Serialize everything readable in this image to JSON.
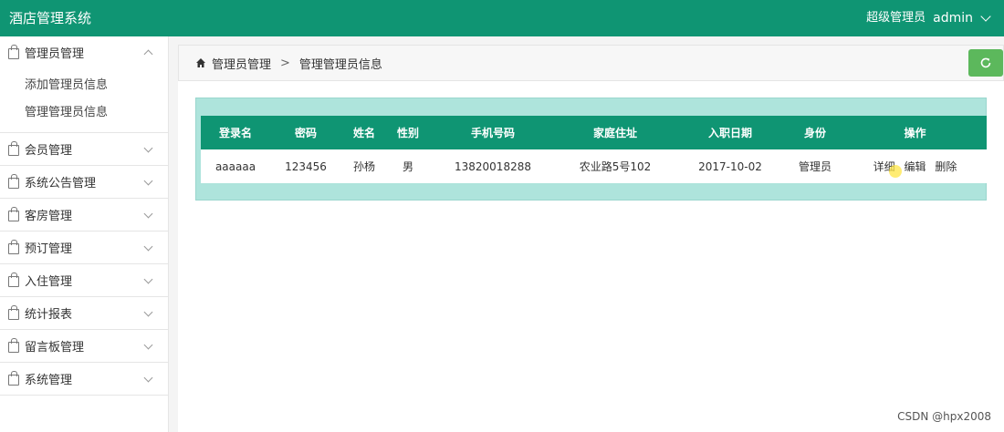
{
  "header": {
    "app_title": "酒店管理系统",
    "role": "超级管理员",
    "username": "admin"
  },
  "sidebar": {
    "groups": [
      {
        "label": "管理员管理",
        "expanded": true,
        "items": [
          "添加管理员信息",
          "管理管理员信息"
        ]
      },
      {
        "label": "会员管理"
      },
      {
        "label": "系统公告管理"
      },
      {
        "label": "客房管理"
      },
      {
        "label": "预订管理"
      },
      {
        "label": "入住管理"
      },
      {
        "label": "统计报表"
      },
      {
        "label": "留言板管理"
      },
      {
        "label": "系统管理"
      }
    ]
  },
  "breadcrumb": {
    "parent": "管理员管理",
    "separator": ">",
    "current": "管理管理员信息"
  },
  "table": {
    "headers": [
      "登录名",
      "密码",
      "姓名",
      "性别",
      "手机号码",
      "家庭住址",
      "入职日期",
      "身份",
      "操作"
    ],
    "rows": [
      [
        "aaaaaa",
        "123456",
        "孙杨",
        "男",
        "13820018288",
        "农业路5号102",
        "2017-10-02",
        "管理员"
      ]
    ],
    "actions": [
      "详细",
      "编辑",
      "删除"
    ]
  },
  "colors": {
    "primary": "#0f9573",
    "refresh": "#5cb85c",
    "table_bg": "#aee4dc"
  },
  "watermark": "CSDN @hpx2008"
}
